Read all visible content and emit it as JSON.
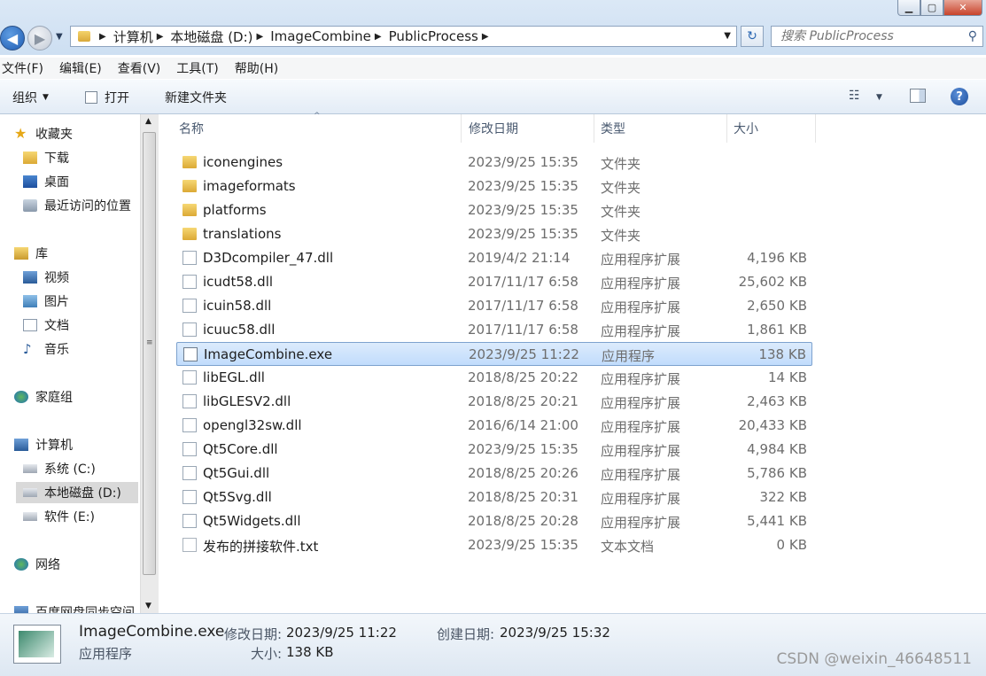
{
  "breadcrumb": [
    "计算机",
    "本地磁盘 (D:)",
    "ImageCombine",
    "PublicProcess"
  ],
  "search": {
    "placeholder": "搜索 PublicProcess"
  },
  "menu": [
    "文件(F)",
    "编辑(E)",
    "查看(V)",
    "工具(T)",
    "帮助(H)"
  ],
  "toolbar": {
    "organize": "组织",
    "open": "打开",
    "new_folder": "新建文件夹"
  },
  "sidebar": {
    "favorites": "收藏夹",
    "downloads": "下载",
    "desktop": "桌面",
    "recent": "最近访问的位置",
    "library": "库",
    "videos": "视频",
    "pictures": "图片",
    "documents": "文档",
    "music": "音乐",
    "homegroup": "家庭组",
    "computer": "计算机",
    "drive_c": "系统 (C:)",
    "drive_d": "本地磁盘 (D:)",
    "drive_e": "软件 (E:)",
    "network": "网络",
    "baidu": "百度网盘同步空间"
  },
  "columns": {
    "name": "名称",
    "date": "修改日期",
    "type": "类型",
    "size": "大小"
  },
  "files": [
    {
      "name": "iconengines",
      "date": "2023/9/25 15:35",
      "type": "文件夹",
      "size": "",
      "kind": "folder"
    },
    {
      "name": "imageformats",
      "date": "2023/9/25 15:35",
      "type": "文件夹",
      "size": "",
      "kind": "folder"
    },
    {
      "name": "platforms",
      "date": "2023/9/25 15:35",
      "type": "文件夹",
      "size": "",
      "kind": "folder"
    },
    {
      "name": "translations",
      "date": "2023/9/25 15:35",
      "type": "文件夹",
      "size": "",
      "kind": "folder"
    },
    {
      "name": "D3Dcompiler_47.dll",
      "date": "2019/4/2 21:14",
      "type": "应用程序扩展",
      "size": "4,196 KB",
      "kind": "dll"
    },
    {
      "name": "icudt58.dll",
      "date": "2017/11/17 6:58",
      "type": "应用程序扩展",
      "size": "25,602 KB",
      "kind": "dll"
    },
    {
      "name": "icuin58.dll",
      "date": "2017/11/17 6:58",
      "type": "应用程序扩展",
      "size": "2,650 KB",
      "kind": "dll"
    },
    {
      "name": "icuuc58.dll",
      "date": "2017/11/17 6:58",
      "type": "应用程序扩展",
      "size": "1,861 KB",
      "kind": "dll"
    },
    {
      "name": "ImageCombine.exe",
      "date": "2023/9/25 11:22",
      "type": "应用程序",
      "size": "138 KB",
      "kind": "exe"
    },
    {
      "name": "libEGL.dll",
      "date": "2018/8/25 20:22",
      "type": "应用程序扩展",
      "size": "14 KB",
      "kind": "dll"
    },
    {
      "name": "libGLESV2.dll",
      "date": "2018/8/25 20:21",
      "type": "应用程序扩展",
      "size": "2,463 KB",
      "kind": "dll"
    },
    {
      "name": "opengl32sw.dll",
      "date": "2016/6/14 21:00",
      "type": "应用程序扩展",
      "size": "20,433 KB",
      "kind": "dll"
    },
    {
      "name": "Qt5Core.dll",
      "date": "2023/9/25 15:35",
      "type": "应用程序扩展",
      "size": "4,984 KB",
      "kind": "dll"
    },
    {
      "name": "Qt5Gui.dll",
      "date": "2018/8/25 20:26",
      "type": "应用程序扩展",
      "size": "5,786 KB",
      "kind": "dll"
    },
    {
      "name": "Qt5Svg.dll",
      "date": "2018/8/25 20:31",
      "type": "应用程序扩展",
      "size": "322 KB",
      "kind": "dll"
    },
    {
      "name": "Qt5Widgets.dll",
      "date": "2018/8/25 20:28",
      "type": "应用程序扩展",
      "size": "5,441 KB",
      "kind": "dll"
    },
    {
      "name": "发布的拼接软件.txt",
      "date": "2023/9/25 15:35",
      "type": "文本文档",
      "size": "0 KB",
      "kind": "txt"
    }
  ],
  "selected_file": "ImageCombine.exe",
  "details": {
    "filename": "ImageCombine.exe",
    "type": "应用程序",
    "modified_label": "修改日期:",
    "modified": "2023/9/25 11:22",
    "created_label": "创建日期:",
    "created": "2023/9/25 15:32",
    "size_label": "大小:",
    "size": "138 KB"
  },
  "watermark": "CSDN @weixin_46648511"
}
